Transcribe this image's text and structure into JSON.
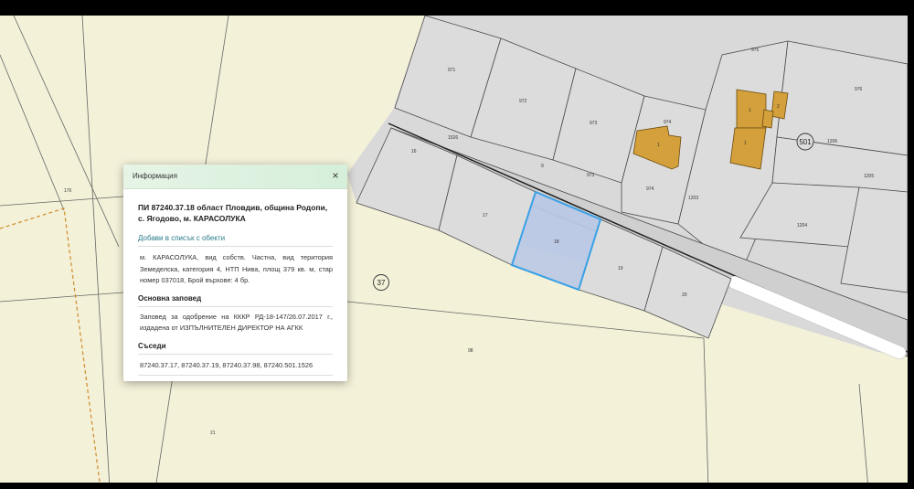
{
  "map": {
    "parcel_labels": [
      "971",
      "972",
      "973",
      "974",
      "975",
      "976",
      "1526",
      "1203",
      "1204",
      "1205",
      "1206",
      "16",
      "17",
      "18",
      "19",
      "20",
      "98",
      "21",
      "170",
      "1",
      "2",
      "9",
      "973",
      "974"
    ],
    "road_badges": [
      "37",
      "501"
    ],
    "colors": {
      "land": "#f3f1d8",
      "grey_zone": "#d9d9d9",
      "parcel_fill": "#dcdcdc",
      "building": "#d3a03b",
      "selected_fill": "#b9c8e6",
      "selected_stroke": "#3aa0e6",
      "green_area": "#d9ecc9"
    }
  },
  "info_panel": {
    "title": "Информация",
    "close_label": "×",
    "parcel_title": "ПИ 87240.37.18 област Пловдив, община Родопи, с. Ягодово, м. КАРАСОЛУКА",
    "add_to_list": "Добави в списък с обекти",
    "description": "м. КАРАСОЛУКА, вид собств. Частна, вид територия Земеделска, категория 4, НТП Нива, площ 379 кв. м, стар номер 037018, Брой върхове: 4 бр.",
    "order_heading": "Основна заповед",
    "order_text": "Заповед за одобрение на КККР РД-18-147/26.07.2017 г., издадена от ИЗПЪЛНИТЕЛЕН ДИРЕКТОР НА АГКК",
    "neighbors_heading": "Съседи",
    "neighbors_text": "87240.37.17, 87240.37.19, 87240.37.98, 87240.501.1526"
  }
}
